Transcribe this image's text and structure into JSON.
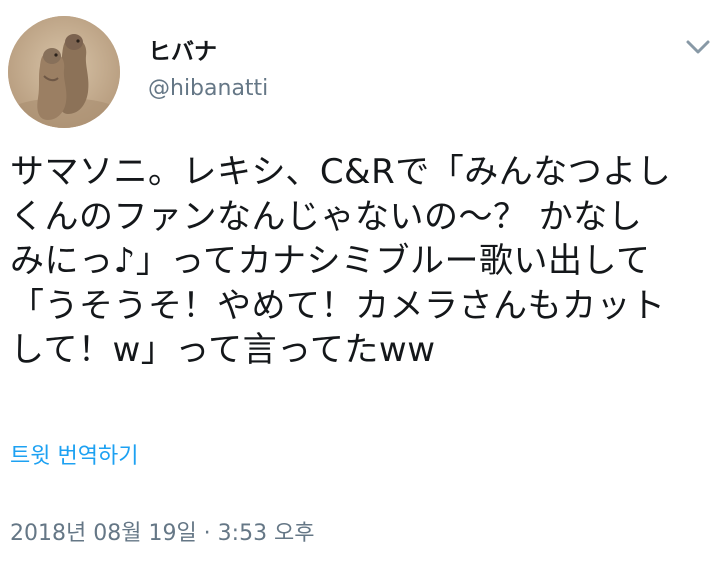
{
  "author": {
    "display_name": "ヒバナ",
    "handle": "@hibanatti",
    "avatar": "meerkats-photo-avatar"
  },
  "menu_icon": "chevron-down-icon",
  "tweet": {
    "lines": [
      "サマソニ。レキシ、C&Rで「みんなつよし",
      "くんのファンなんじゃないの～？ かなし",
      "みにっ♪」ってカナシミブルー歌い出して",
      "「うそうそ！やめて！カメラさんもカット",
      "して！w」って言ってたww"
    ]
  },
  "translate_label": "트윗 번역하기",
  "timestamp": "2018년 08월 19일 · 3:53 오후",
  "colors": {
    "text": "#14171a",
    "secondary": "#657786",
    "link": "#1da1f2"
  }
}
